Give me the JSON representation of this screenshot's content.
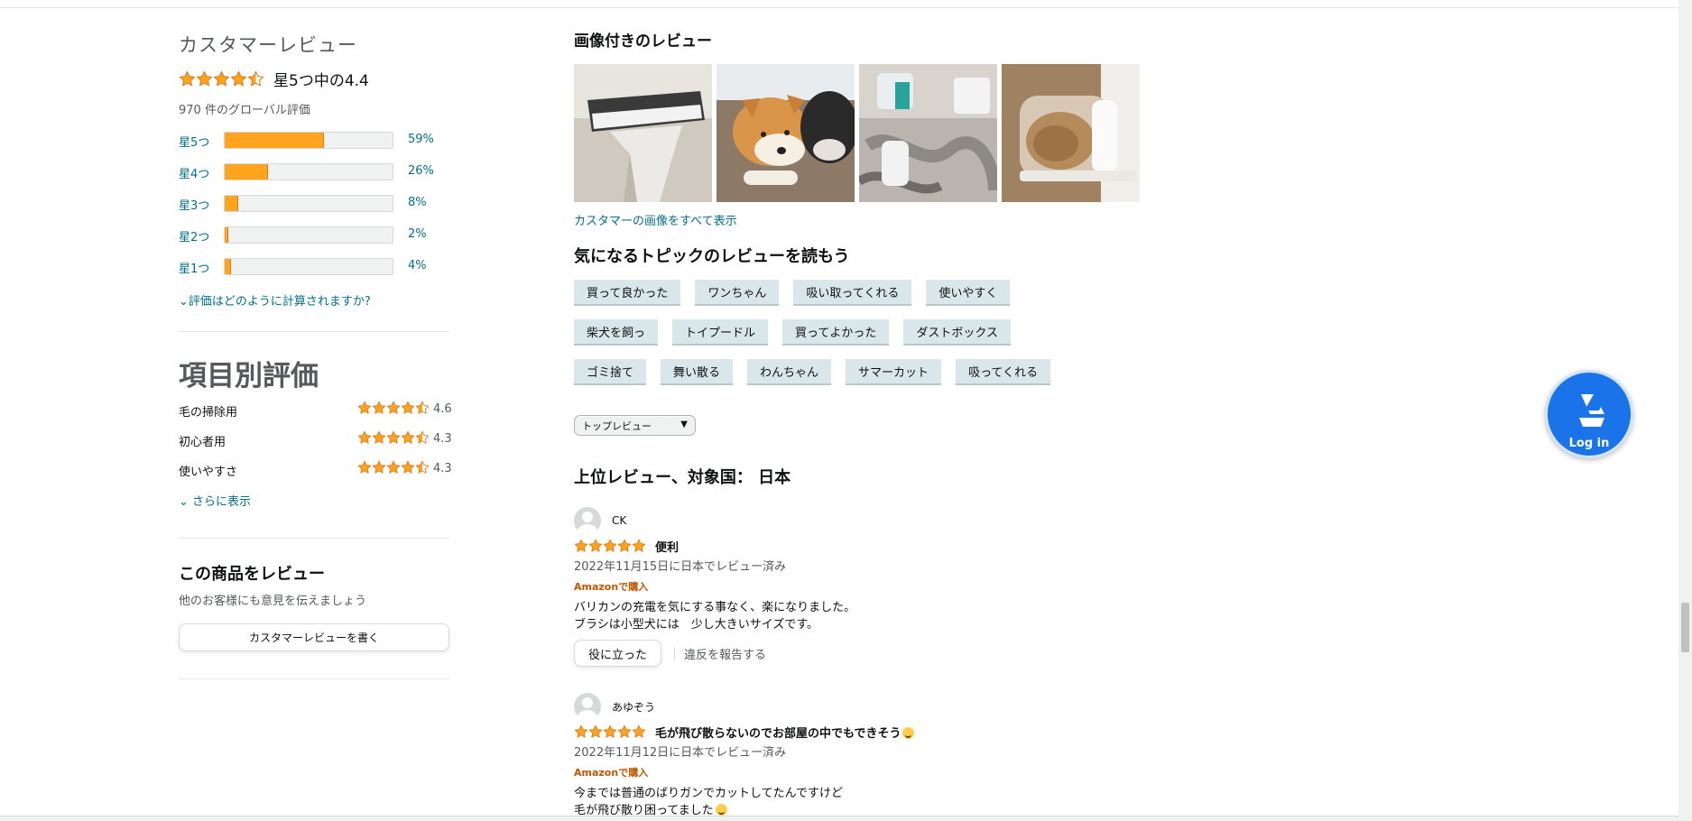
{
  "left": {
    "title": "カスタマーレビュー",
    "overall_rating": 4.4,
    "overall_text": "星5つ中の4.4",
    "global_count": "970 件のグローバル評価",
    "histogram": [
      {
        "label": "星5つ",
        "percent": 59,
        "percent_text": "59%"
      },
      {
        "label": "星4つ",
        "percent": 26,
        "percent_text": "26%"
      },
      {
        "label": "星3つ",
        "percent": 8,
        "percent_text": "8%"
      },
      {
        "label": "星2つ",
        "percent": 2,
        "percent_text": "2%"
      },
      {
        "label": "星1つ",
        "percent": 4,
        "percent_text": "4%"
      }
    ],
    "how_calc": "評価はどのように計算されますか?",
    "attributes_title": "項目別評価",
    "attributes": [
      {
        "name": "毛の掃除用",
        "rating": 4.6,
        "value": "4.6"
      },
      {
        "name": "初心者用",
        "rating": 4.3,
        "value": "4.3"
      },
      {
        "name": "使いやすさ",
        "rating": 4.3,
        "value": "4.3"
      }
    ],
    "see_more": "さらに表示",
    "write_title": "この商品をレビュー",
    "write_sub": "他のお客様にも意見を伝えましょう",
    "write_button": "カスタマーレビューを書く"
  },
  "right": {
    "images_title": "画像付きのレビュー",
    "see_all_images": "カスタマーの画像をすべて表示",
    "topics_title": "気になるトピックのレビューを読もう",
    "topics": [
      [
        "買って良かった",
        "ワンちゃん",
        "吸い取ってくれる",
        "使いやすく"
      ],
      [
        "柴犬を飼っ",
        "トイプードル",
        "買ってよかった",
        "ダストボックス"
      ],
      [
        "ゴミ捨て",
        "舞い散る",
        "わんちゃん",
        "サマーカット",
        "吸ってくれる"
      ]
    ],
    "sort_selected": "トップレビュー",
    "top_reviews_title": "上位レビュー、対象国： 日本",
    "reviews": [
      {
        "name": "CK",
        "rating": 5,
        "title": "便利",
        "date": "2022年11月15日に日本でレビュー済み",
        "verified": "Amazonで購入",
        "body_lines": [
          "バリカンの充電を気にする事なく、楽になりました。",
          "ブラシは小型犬には　少し大きいサイズです。"
        ],
        "helpful": "役に立った",
        "report": "違反を報告する"
      },
      {
        "name": "あゆぞう",
        "rating": 5,
        "title": "毛が飛び散らないのでお部屋の中でもできそう",
        "date": "2022年11月12日に日本でレビュー済み",
        "verified": "Amazonで購入",
        "body_lines": [
          "今までは普通のばりガンでカットしてたんですけど",
          "毛が飛び散り困ってました"
        ]
      }
    ]
  },
  "login": {
    "label": "Log in"
  },
  "colors": {
    "star": "#ffa41c",
    "link": "#007185",
    "orange": "#c45500",
    "chip": "#d9e6ea",
    "login_blue": "#1a73e8"
  }
}
